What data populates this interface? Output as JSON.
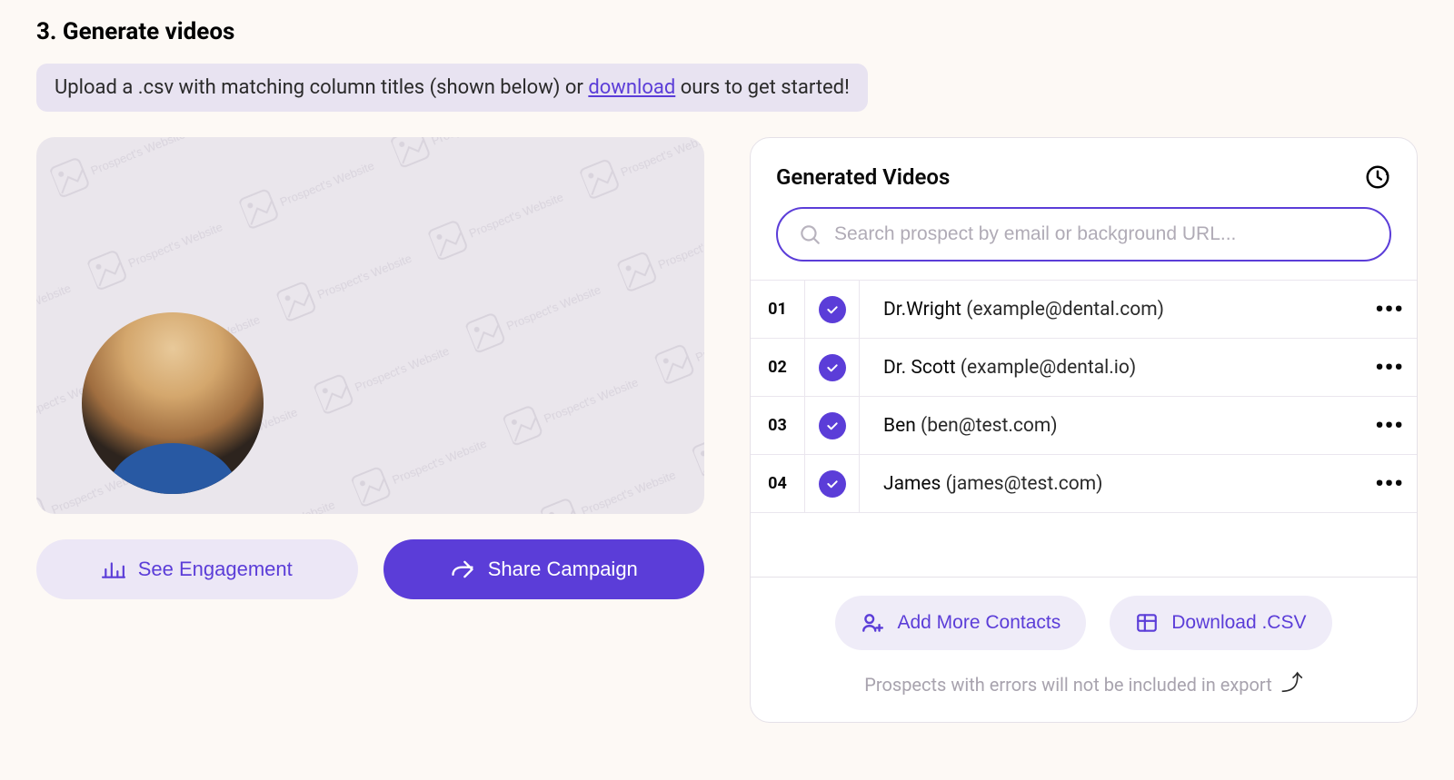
{
  "section": {
    "title": "3. Generate videos",
    "banner_prefix": "Upload a .csv with matching column titles (shown below) or ",
    "banner_link": "download",
    "banner_suffix": " ours to get started!"
  },
  "buttons": {
    "engagement": "See Engagement",
    "share": "Share Campaign"
  },
  "panel": {
    "title": "Generated Videos",
    "search_placeholder": "Search prospect by email or background URL...",
    "add_contacts": "Add More Contacts",
    "download_csv": "Download .CSV",
    "footnote": "Prospects with errors will not be included in export"
  },
  "rows": [
    {
      "num": "01",
      "name": "Dr.Wright",
      "email_display": "(example@dental.com)"
    },
    {
      "num": "02",
      "name": "Dr. Scott",
      "email_display": "(example@dental.io)"
    },
    {
      "num": "03",
      "name": "Ben",
      "email_display": "(ben@test.com)"
    },
    {
      "num": "04",
      "name": "James",
      "email_display": "(james@test.com)"
    }
  ]
}
